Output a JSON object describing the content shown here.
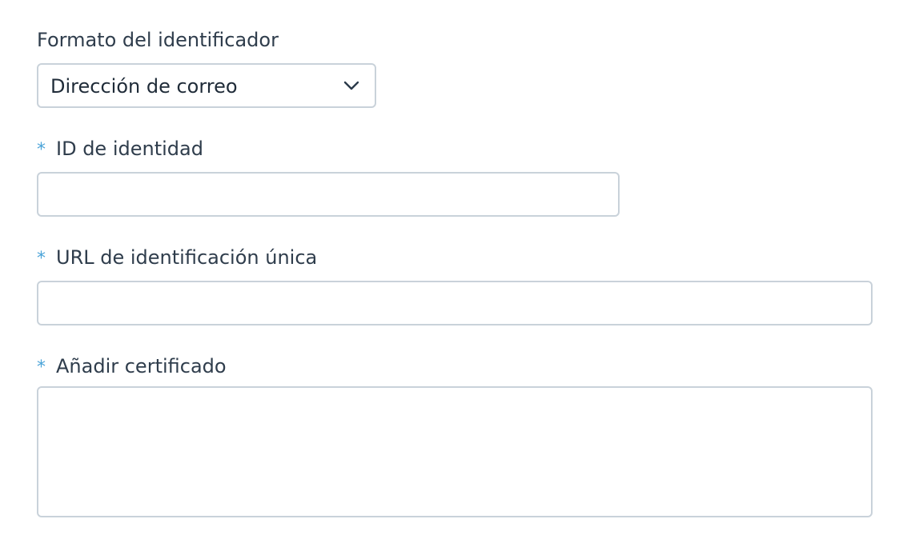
{
  "form": {
    "format": {
      "label": "Formato del identificador",
      "selected": "Dirección de correo",
      "chevron_icon": "chevron-down-icon"
    },
    "identity_id": {
      "required_mark": "*",
      "label": "ID de identidad",
      "value": ""
    },
    "unique_url": {
      "required_mark": "*",
      "label": "URL de identificación única",
      "value": ""
    },
    "certificate": {
      "required_mark": "*",
      "label": "Añadir certificado",
      "value": ""
    }
  },
  "colors": {
    "required_star": "#4aa3d8",
    "border": "#c9d2da",
    "label_text": "#2f3d4c"
  }
}
